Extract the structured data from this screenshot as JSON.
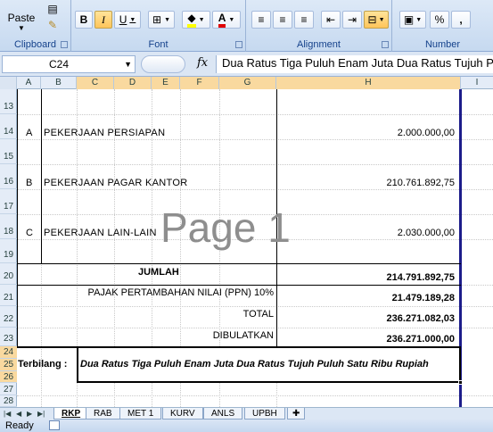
{
  "ribbon": {
    "clipboard": {
      "label": "Clipboard",
      "paste_label": "Paste"
    },
    "font": {
      "label": "Font",
      "bold": "B",
      "italic": "I",
      "underline": "U",
      "font_color_letter": "A"
    },
    "alignment": {
      "label": "Alignment"
    },
    "number": {
      "label": "Number",
      "percent": "%",
      "comma": ","
    }
  },
  "formula_bar": {
    "name_box": "C24",
    "fx": "fx",
    "formula": "Dua Ratus Tiga Puluh Enam Juta Dua Ratus Tujuh P"
  },
  "columns": [
    "A",
    "B",
    "C",
    "D",
    "E",
    "F",
    "G",
    "H",
    "I"
  ],
  "rows": [
    "13",
    "14",
    "15",
    "16",
    "17",
    "18",
    "19",
    "20",
    "21",
    "22",
    "23",
    "24",
    "25",
    "26",
    "27",
    "28"
  ],
  "items": [
    {
      "letter": "A",
      "name": "PEKERJAAN PERSIAPAN",
      "amount": "2.000.000,00"
    },
    {
      "letter": "B",
      "name": "PEKERJAAN PAGAR KANTOR",
      "amount": "210.761.892,75"
    },
    {
      "letter": "C",
      "name": "PEKERJAAN LAIN-LAIN",
      "amount": "2.030.000,00"
    }
  ],
  "summary": {
    "jumlah_label": "JUMLAH",
    "jumlah_value": "214.791.892,75",
    "ppn_label": "PAJAK PERTAMBAHAN NILAI (PPN) 10%",
    "ppn_value": "21.479.189,28",
    "total_label": "TOTAL",
    "total_value": "236.271.082,03",
    "dibulatkan_label": "DIBULATKAN",
    "dibulatkan_value": "236.271.000,00"
  },
  "terbilang": {
    "label": "Terbilang  :",
    "text": "Dua Ratus Tiga Puluh Enam Juta Dua Ratus Tujuh Puluh Satu Ribu Rupiah"
  },
  "watermark": "Page 1",
  "sheet_tabs": [
    "RKP",
    "RAB",
    "MET 1",
    "KURV",
    "ANLS",
    "UPBH"
  ],
  "active_tab": "RKP",
  "status": {
    "text": "Ready"
  }
}
